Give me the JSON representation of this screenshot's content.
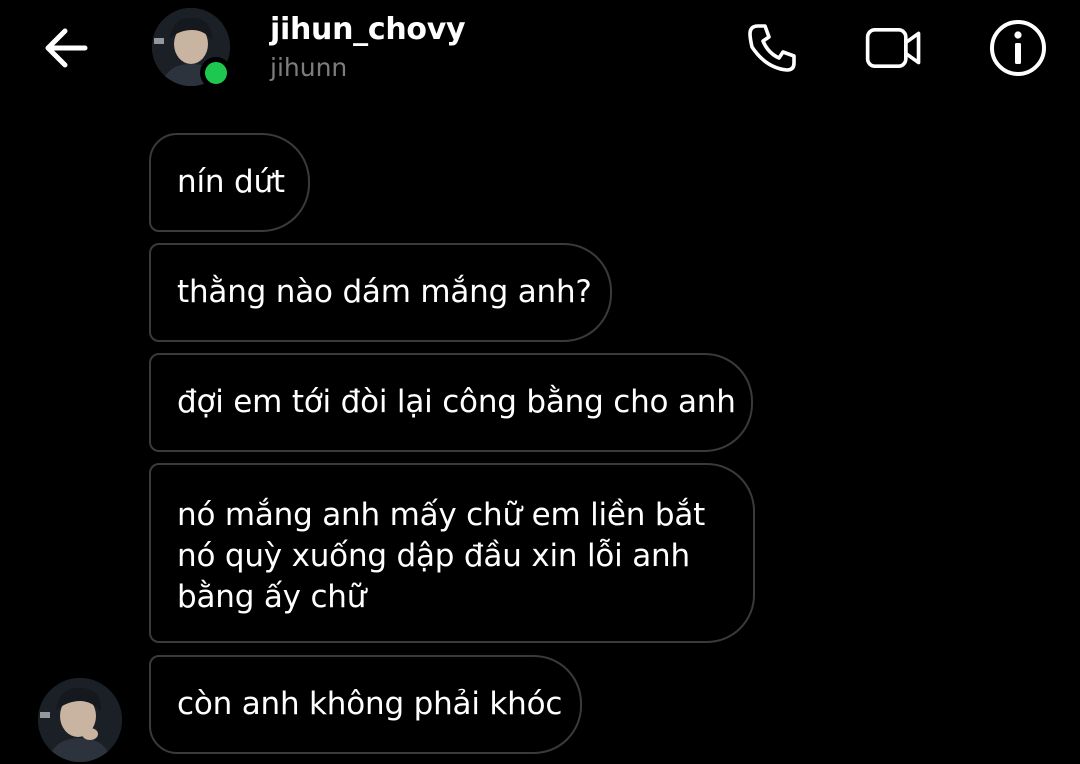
{
  "header": {
    "display_name": "jihun_chovy",
    "username": "jihunn",
    "online": true
  },
  "icons": {
    "back": "arrow-left-icon",
    "call": "phone-icon",
    "video": "video-camera-icon",
    "info": "info-circle-icon"
  },
  "colors": {
    "background": "#000000",
    "bubble_border": "#3a3a3a",
    "online_indicator": "#1ec84f",
    "secondary_text": "#7d7d7d"
  },
  "messages": [
    {
      "text": "nín dứt"
    },
    {
      "text": "thằng nào dám mắng anh?"
    },
    {
      "text": "đợi em tới đòi lại công bằng cho anh"
    },
    {
      "text": "nó mắng anh mấy chữ em liền bắt nó quỳ xuống dập đầu xin lỗi anh bằng ấy chữ"
    },
    {
      "text": "còn anh không phải khóc"
    }
  ]
}
